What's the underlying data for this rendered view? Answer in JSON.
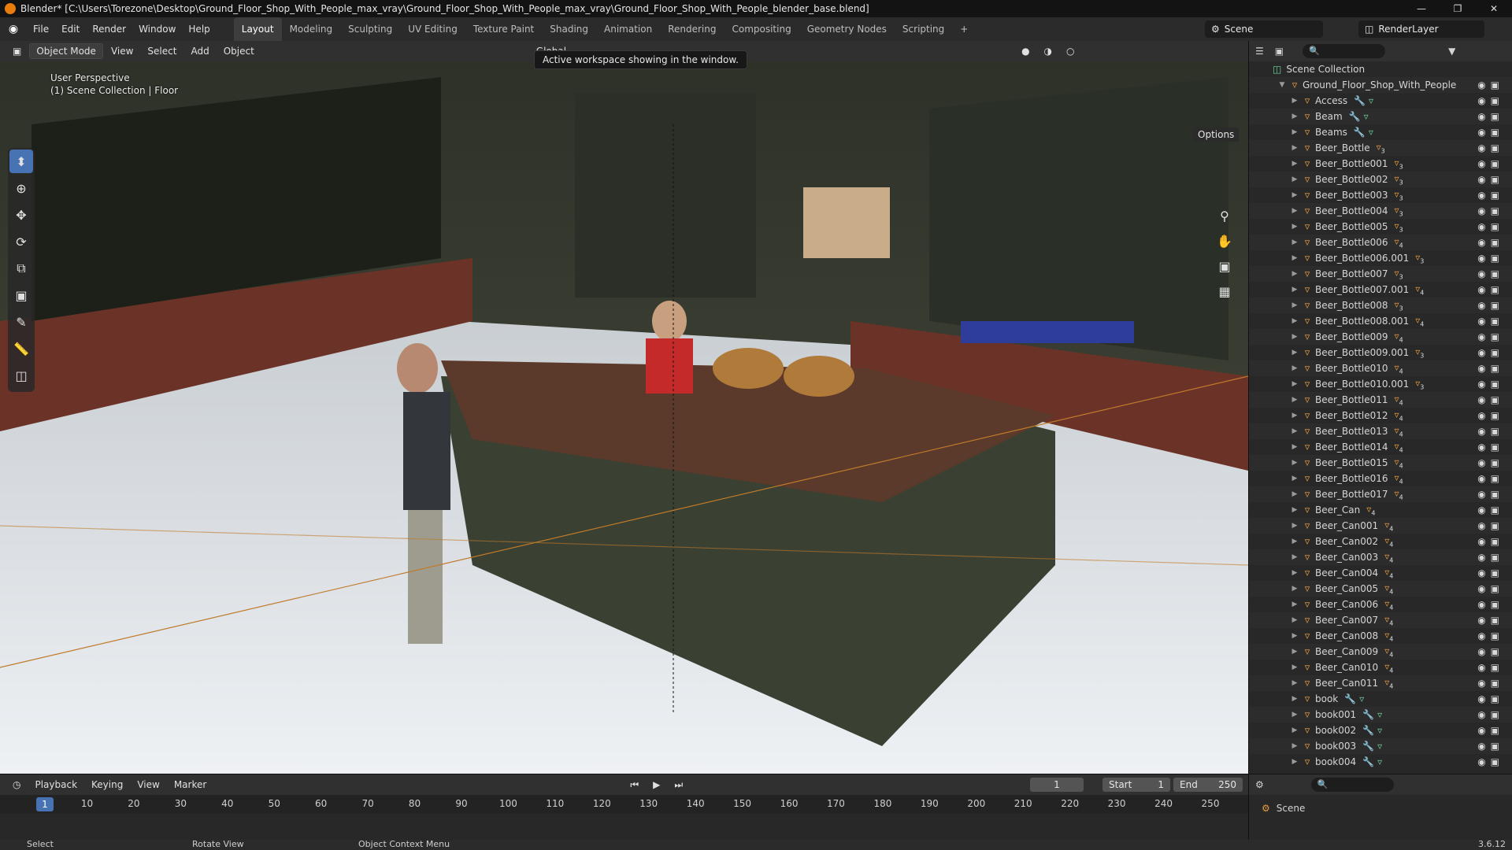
{
  "window": {
    "title": "Blender* [C:\\Users\\Torezone\\Desktop\\Ground_Floor_Shop_With_People_max_vray\\Ground_Floor_Shop_With_People_max_vray\\Ground_Floor_Shop_With_People_blender_base.blend]"
  },
  "menu": [
    "File",
    "Edit",
    "Render",
    "Window",
    "Help"
  ],
  "workspaces": [
    "Layout",
    "Modeling",
    "Sculpting",
    "UV Editing",
    "Texture Paint",
    "Shading",
    "Animation",
    "Rendering",
    "Compositing",
    "Geometry Nodes",
    "Scripting",
    "+"
  ],
  "scene_name": "Scene",
  "render_layer": "RenderLayer",
  "viewport_header": {
    "mode": "Object Mode",
    "menus": [
      "View",
      "Select",
      "Add",
      "Object"
    ],
    "transform": "Global"
  },
  "tooltip": "Active workspace showing in the window.",
  "viewport": {
    "perspective": "User Perspective",
    "collection": "(1) Scene Collection | Floor",
    "options": "Options"
  },
  "outliner": {
    "root": "Scene Collection",
    "collection": "Ground_Floor_Shop_With_People",
    "items": [
      {
        "name": "Access",
        "badge": ""
      },
      {
        "name": "Beam",
        "badge": ""
      },
      {
        "name": "Beams",
        "badge": ""
      },
      {
        "name": "Beer_Bottle",
        "badge": "3"
      },
      {
        "name": "Beer_Bottle001",
        "badge": "3"
      },
      {
        "name": "Beer_Bottle002",
        "badge": "3"
      },
      {
        "name": "Beer_Bottle003",
        "badge": "3"
      },
      {
        "name": "Beer_Bottle004",
        "badge": "3"
      },
      {
        "name": "Beer_Bottle005",
        "badge": "3"
      },
      {
        "name": "Beer_Bottle006",
        "badge": "4"
      },
      {
        "name": "Beer_Bottle006.001",
        "badge": "3"
      },
      {
        "name": "Beer_Bottle007",
        "badge": "3"
      },
      {
        "name": "Beer_Bottle007.001",
        "badge": "4"
      },
      {
        "name": "Beer_Bottle008",
        "badge": "3"
      },
      {
        "name": "Beer_Bottle008.001",
        "badge": "4"
      },
      {
        "name": "Beer_Bottle009",
        "badge": "4"
      },
      {
        "name": "Beer_Bottle009.001",
        "badge": "3"
      },
      {
        "name": "Beer_Bottle010",
        "badge": "4"
      },
      {
        "name": "Beer_Bottle010.001",
        "badge": "3"
      },
      {
        "name": "Beer_Bottle011",
        "badge": "4"
      },
      {
        "name": "Beer_Bottle012",
        "badge": "4"
      },
      {
        "name": "Beer_Bottle013",
        "badge": "4"
      },
      {
        "name": "Beer_Bottle014",
        "badge": "4"
      },
      {
        "name": "Beer_Bottle015",
        "badge": "4"
      },
      {
        "name": "Beer_Bottle016",
        "badge": "4"
      },
      {
        "name": "Beer_Bottle017",
        "badge": "4"
      },
      {
        "name": "Beer_Can",
        "badge": "4"
      },
      {
        "name": "Beer_Can001",
        "badge": "4"
      },
      {
        "name": "Beer_Can002",
        "badge": "4"
      },
      {
        "name": "Beer_Can003",
        "badge": "4"
      },
      {
        "name": "Beer_Can004",
        "badge": "4"
      },
      {
        "name": "Beer_Can005",
        "badge": "4"
      },
      {
        "name": "Beer_Can006",
        "badge": "4"
      },
      {
        "name": "Beer_Can007",
        "badge": "4"
      },
      {
        "name": "Beer_Can008",
        "badge": "4"
      },
      {
        "name": "Beer_Can009",
        "badge": "4"
      },
      {
        "name": "Beer_Can010",
        "badge": "4"
      },
      {
        "name": "Beer_Can011",
        "badge": "4"
      },
      {
        "name": "book",
        "badge": ""
      },
      {
        "name": "book001",
        "badge": ""
      },
      {
        "name": "book002",
        "badge": ""
      },
      {
        "name": "book003",
        "badge": ""
      },
      {
        "name": "book004",
        "badge": ""
      }
    ]
  },
  "timeline": {
    "menus": [
      "Playback",
      "Keying",
      "View",
      "Marker"
    ],
    "current_frame": "1",
    "start_label": "Start",
    "start": "1",
    "end_label": "End",
    "end": "250",
    "ticks": [
      "10",
      "20",
      "30",
      "40",
      "50",
      "60",
      "70",
      "80",
      "90",
      "100",
      "110",
      "120",
      "130",
      "140",
      "150",
      "160",
      "170",
      "180",
      "190",
      "200",
      "210",
      "220",
      "230",
      "240",
      "250"
    ]
  },
  "properties": {
    "scene": "Scene"
  },
  "status": {
    "select": "Select",
    "rotate": "Rotate View",
    "context": "Object Context Menu",
    "version": "3.6.12"
  },
  "colors": {
    "accent": "#4772b3",
    "object": "#e89c40",
    "mesh": "#6fd19a"
  }
}
